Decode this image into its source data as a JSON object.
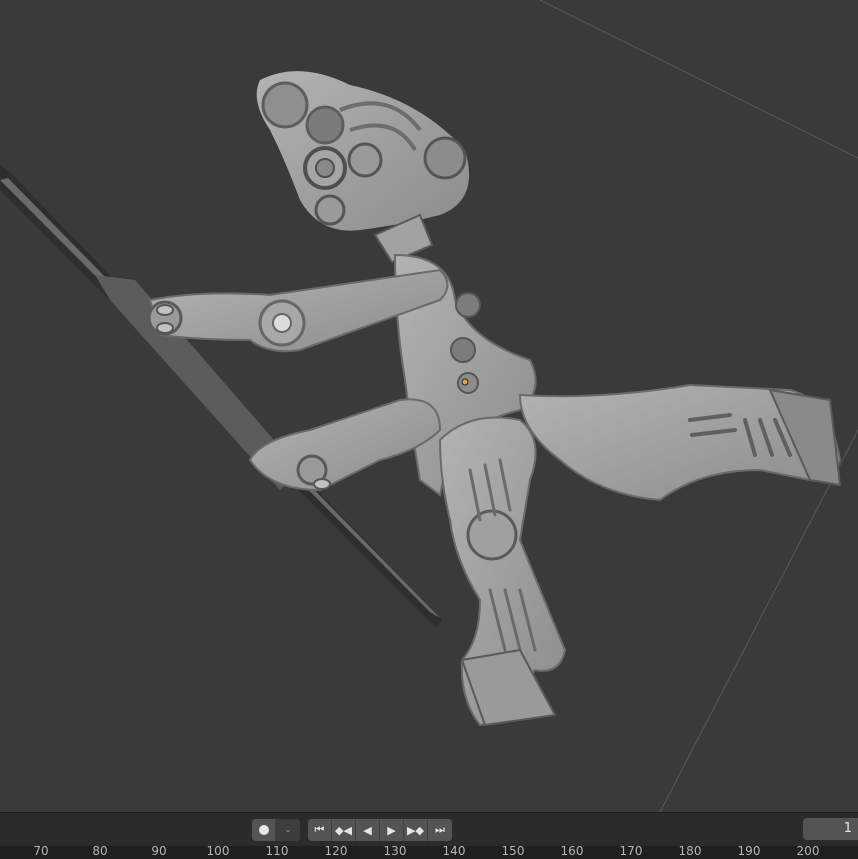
{
  "timeline": {
    "record_icon": "record-icon",
    "keying_dropdown_icon": "chevron-down-icon",
    "playback_buttons": [
      {
        "name": "jump-to-start-button",
        "glyph": "⏮"
      },
      {
        "name": "prev-keyframe-button",
        "glyph": "◆◀"
      },
      {
        "name": "play-reverse-button",
        "glyph": "◀"
      },
      {
        "name": "play-button",
        "glyph": "▶"
      },
      {
        "name": "next-keyframe-button",
        "glyph": "▶◆"
      },
      {
        "name": "jump-to-end-button",
        "glyph": "⏭"
      }
    ],
    "current_frame": "1",
    "ruler_ticks": [
      "70",
      "80",
      "90",
      "100",
      "110",
      "120",
      "130",
      "140",
      "150",
      "160",
      "170",
      "180",
      "190",
      "200"
    ]
  },
  "colors": {
    "viewport_bg": "#3a3a3a",
    "model_fill": "#9a9a9a",
    "origin_dot": "#e8a33a"
  }
}
